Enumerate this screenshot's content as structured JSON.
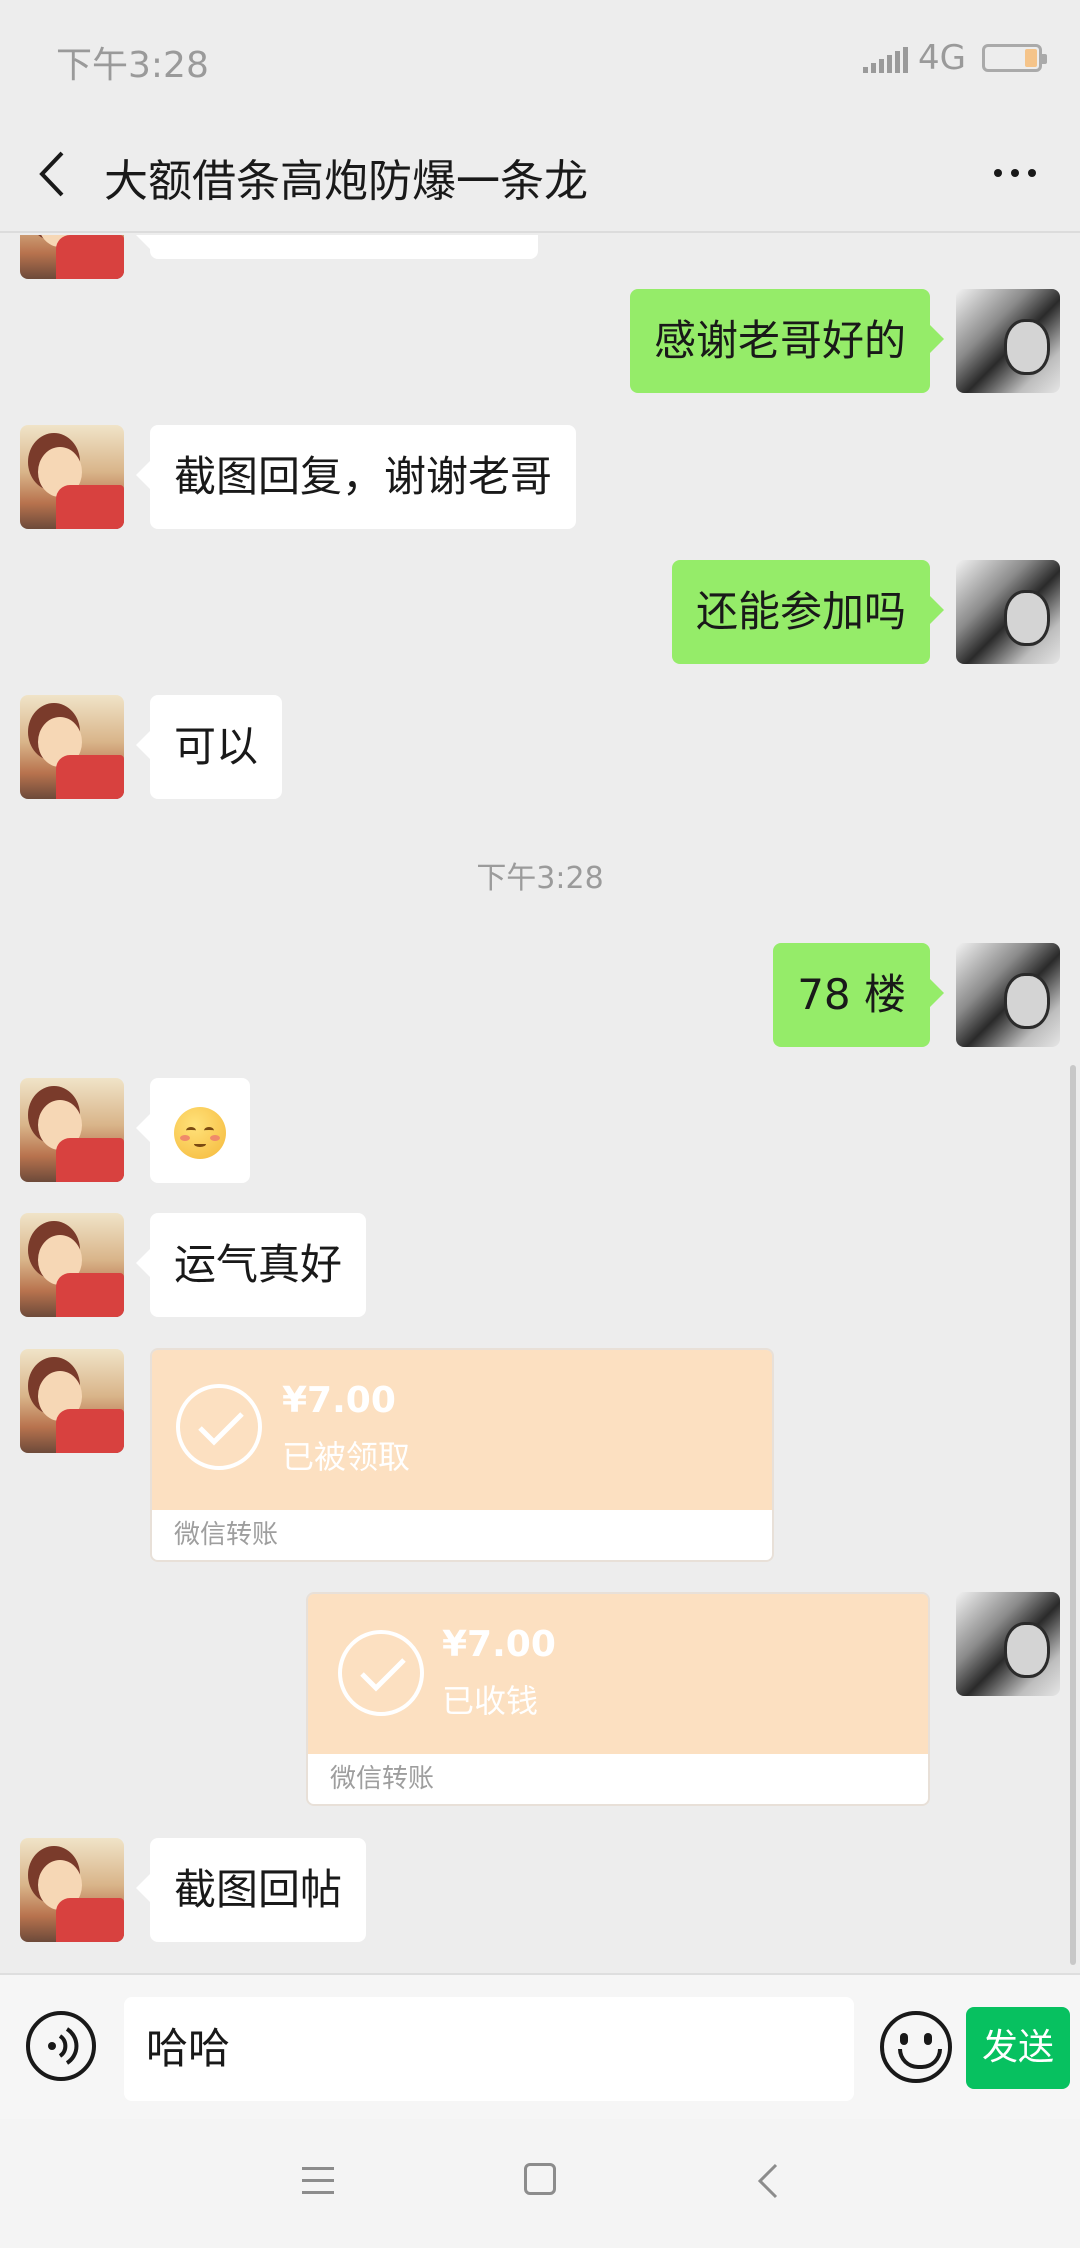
{
  "status_bar": {
    "time": "下午3:28",
    "network": "4G"
  },
  "header": {
    "title": "大额借条高炮防爆一条龙"
  },
  "messages": [
    {
      "side": "right",
      "text": "感谢老哥好的"
    },
    {
      "side": "left",
      "text": "截图回复，谢谢老哥"
    },
    {
      "side": "right",
      "text": "还能参加吗"
    },
    {
      "side": "left",
      "text": "可以"
    },
    {
      "timestamp": "下午3:28"
    },
    {
      "side": "right",
      "text": "78 楼"
    },
    {
      "side": "left",
      "emoji": "smiling-face-emoji"
    },
    {
      "side": "left",
      "text": "运气真好"
    },
    {
      "side": "left",
      "transfer": {
        "amount": "¥7.00",
        "status": "已被领取",
        "label": "微信转账"
      }
    },
    {
      "side": "right",
      "transfer": {
        "amount": "¥7.00",
        "status": "已收钱",
        "label": "微信转账"
      }
    },
    {
      "side": "left",
      "text": "截图回帖"
    }
  ],
  "input": {
    "value": "哈哈",
    "send_label": "发送"
  },
  "colors": {
    "self_bubble": "#95ec69",
    "other_bubble": "#ffffff",
    "transfer": "#fce0c1",
    "send_button": "#07c160",
    "background": "#ededed"
  },
  "icons": {
    "back": "chevron-left-icon",
    "more": "more-dots-icon",
    "voice": "voice-icon",
    "emoji": "emoji-icon"
  }
}
